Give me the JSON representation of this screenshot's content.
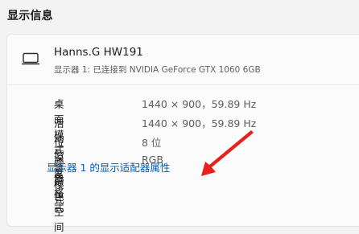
{
  "section": {
    "title": "显示信息"
  },
  "monitor": {
    "name": "Hanns.G HW191",
    "subtitle": "显示器 1: 已连接到 NVIDIA GeForce GTX 1060 6GB",
    "icon": "monitor-icon"
  },
  "details": [
    {
      "label": "桌面模式",
      "value": "1440 × 900，59.89 Hz"
    },
    {
      "label": "活动信号模式",
      "value": "1440 × 900，59.89 Hz"
    },
    {
      "label": "位深度",
      "value": "8 位"
    },
    {
      "label": "颜色格式",
      "value": "RGB"
    },
    {
      "label": "颜色空间",
      "value": ""
    }
  ],
  "adapter_link": "显示器 1 的显示适配器属性",
  "colors": {
    "background": "#f3f3f3",
    "card": "#fbfbfb",
    "link": "#005fb8",
    "arrow": "#e8211d"
  }
}
